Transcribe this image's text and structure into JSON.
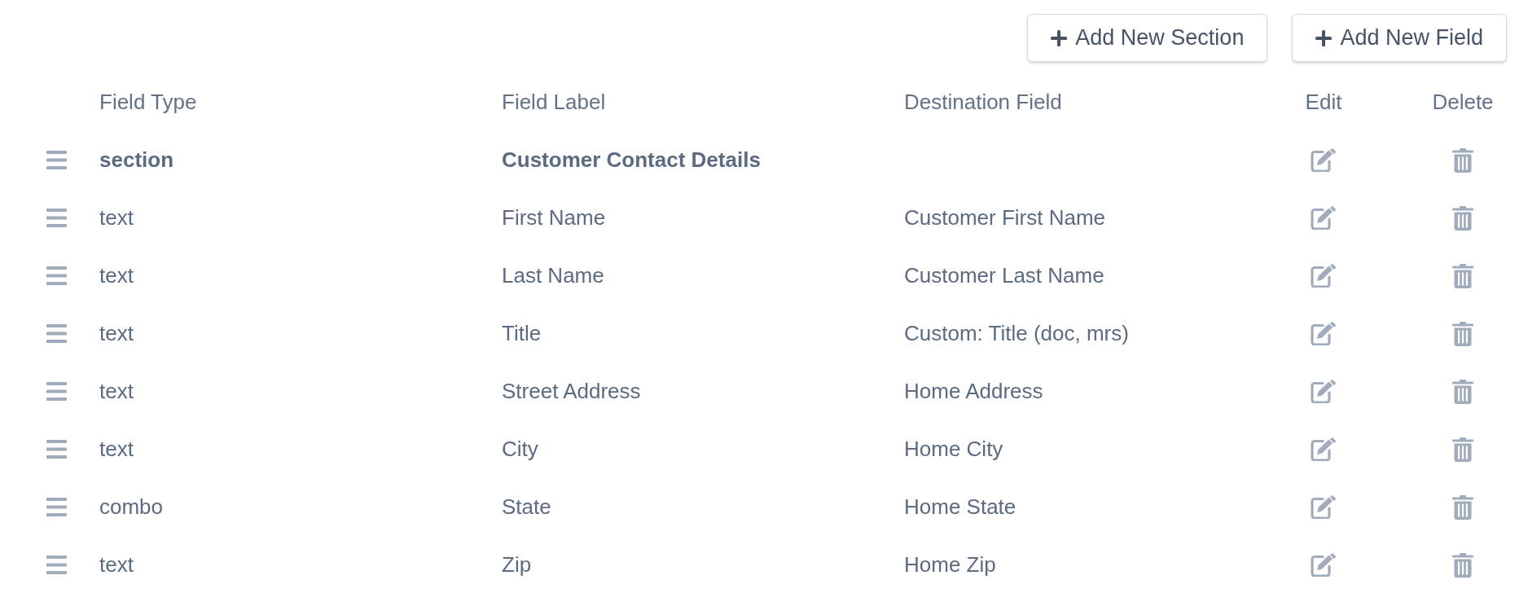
{
  "toolbar": {
    "buttons": [
      {
        "kind": "add",
        "label": "Add New Section"
      },
      {
        "kind": "add",
        "label": "Add New Field"
      }
    ]
  },
  "table": {
    "columns": [
      "Field Type",
      "Field Label",
      "Destination Field",
      "Edit",
      "Delete"
    ],
    "rows": [
      {
        "kind": "section",
        "field_type": "section",
        "field_label": "Customer Contact Details"
      },
      {
        "kind": "field",
        "field_type": "text",
        "field_label": "First Name",
        "destination_field": "Customer First Name"
      },
      {
        "kind": "field",
        "field_type": "text",
        "field_label": "Last Name",
        "destination_field": "Customer Last Name"
      },
      {
        "kind": "field",
        "field_type": "text",
        "field_label": "Title",
        "destination_field": "Custom: Title (doc, mrs)"
      },
      {
        "kind": "field",
        "field_type": "text",
        "field_label": "Street Address",
        "destination_field": "Home Address"
      },
      {
        "kind": "field",
        "field_type": "text",
        "field_label": "City",
        "destination_field": "Home City"
      },
      {
        "kind": "field",
        "field_type": "combo",
        "field_label": "State",
        "destination_field": "Home State"
      },
      {
        "kind": "field",
        "field_type": "text",
        "field_label": "Zip",
        "destination_field": "Home Zip"
      }
    ]
  }
}
